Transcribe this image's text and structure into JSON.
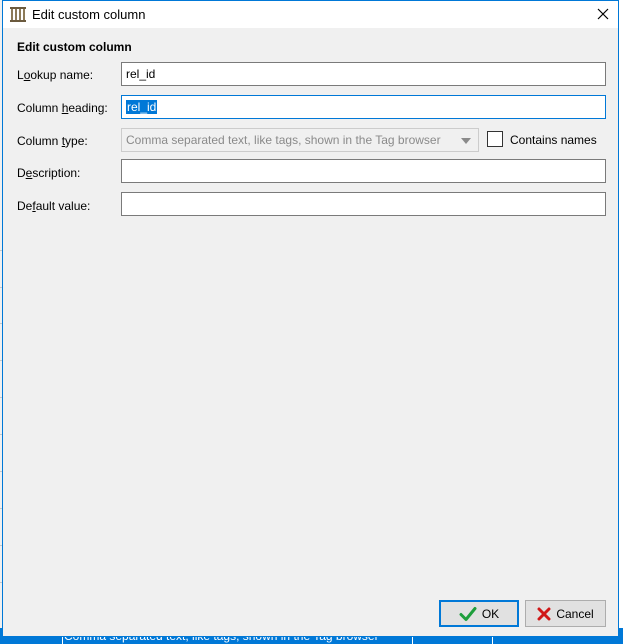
{
  "window": {
    "title": "Edit custom column",
    "close_glyph": "✕"
  },
  "form": {
    "heading": "Edit custom column",
    "lookup_name": {
      "label_pre": "L",
      "label_ul": "o",
      "label_post": "okup name:",
      "value": "rel_id"
    },
    "column_heading": {
      "label_pre": "Column ",
      "label_ul": "h",
      "label_post": "eading:",
      "value": "rel_id"
    },
    "column_type": {
      "label_pre": "Column ",
      "label_ul": "t",
      "label_post": "ype:",
      "selected": "Comma separated text, like tags, shown in the Tag browser"
    },
    "contains_names": {
      "label": "Contains names",
      "checked": false
    },
    "description": {
      "label_pre": "D",
      "label_ul": "e",
      "label_post": "scription:",
      "value": ""
    },
    "default_value": {
      "label_pre": "De",
      "label_ul": "f",
      "label_post": "ault value:",
      "value": ""
    }
  },
  "buttons": {
    "ok": "OK",
    "cancel": "Cancel"
  },
  "background": {
    "row_text": "Comma separated text, like tags, shown in the Tag browser"
  },
  "colors": {
    "accent": "#0078d7",
    "ok_check": "#1e9e3c",
    "cancel_x": "#d01818"
  }
}
